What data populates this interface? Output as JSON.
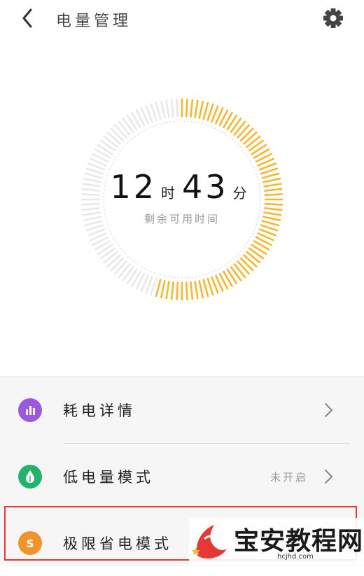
{
  "header": {
    "title": "电量管理",
    "back_icon": "chevron-left-icon",
    "settings_icon": "gear-icon"
  },
  "gauge": {
    "hours": "12",
    "hours_unit": "时",
    "minutes": "43",
    "minutes_unit": "分",
    "subtitle": "剩余可用时间",
    "battery_fraction": 0.55,
    "fill_color": "#f3b731",
    "empty_color": "#e8e8e8"
  },
  "menu": [
    {
      "label": "耗电详情",
      "status": "",
      "icon": "bar-chart-icon",
      "icon_color": "#9b59e0"
    },
    {
      "label": "低电量模式",
      "status": "未开启",
      "icon": "leaf-drop-icon",
      "icon_color": "#22b46a"
    },
    {
      "label": "极限省电模式",
      "status": "",
      "icon": "s-letter-icon",
      "icon_letter": "S",
      "icon_color": "#f0932b"
    }
  ],
  "watermark": {
    "text": "宝安教程网",
    "url": "hcjhd.com"
  }
}
